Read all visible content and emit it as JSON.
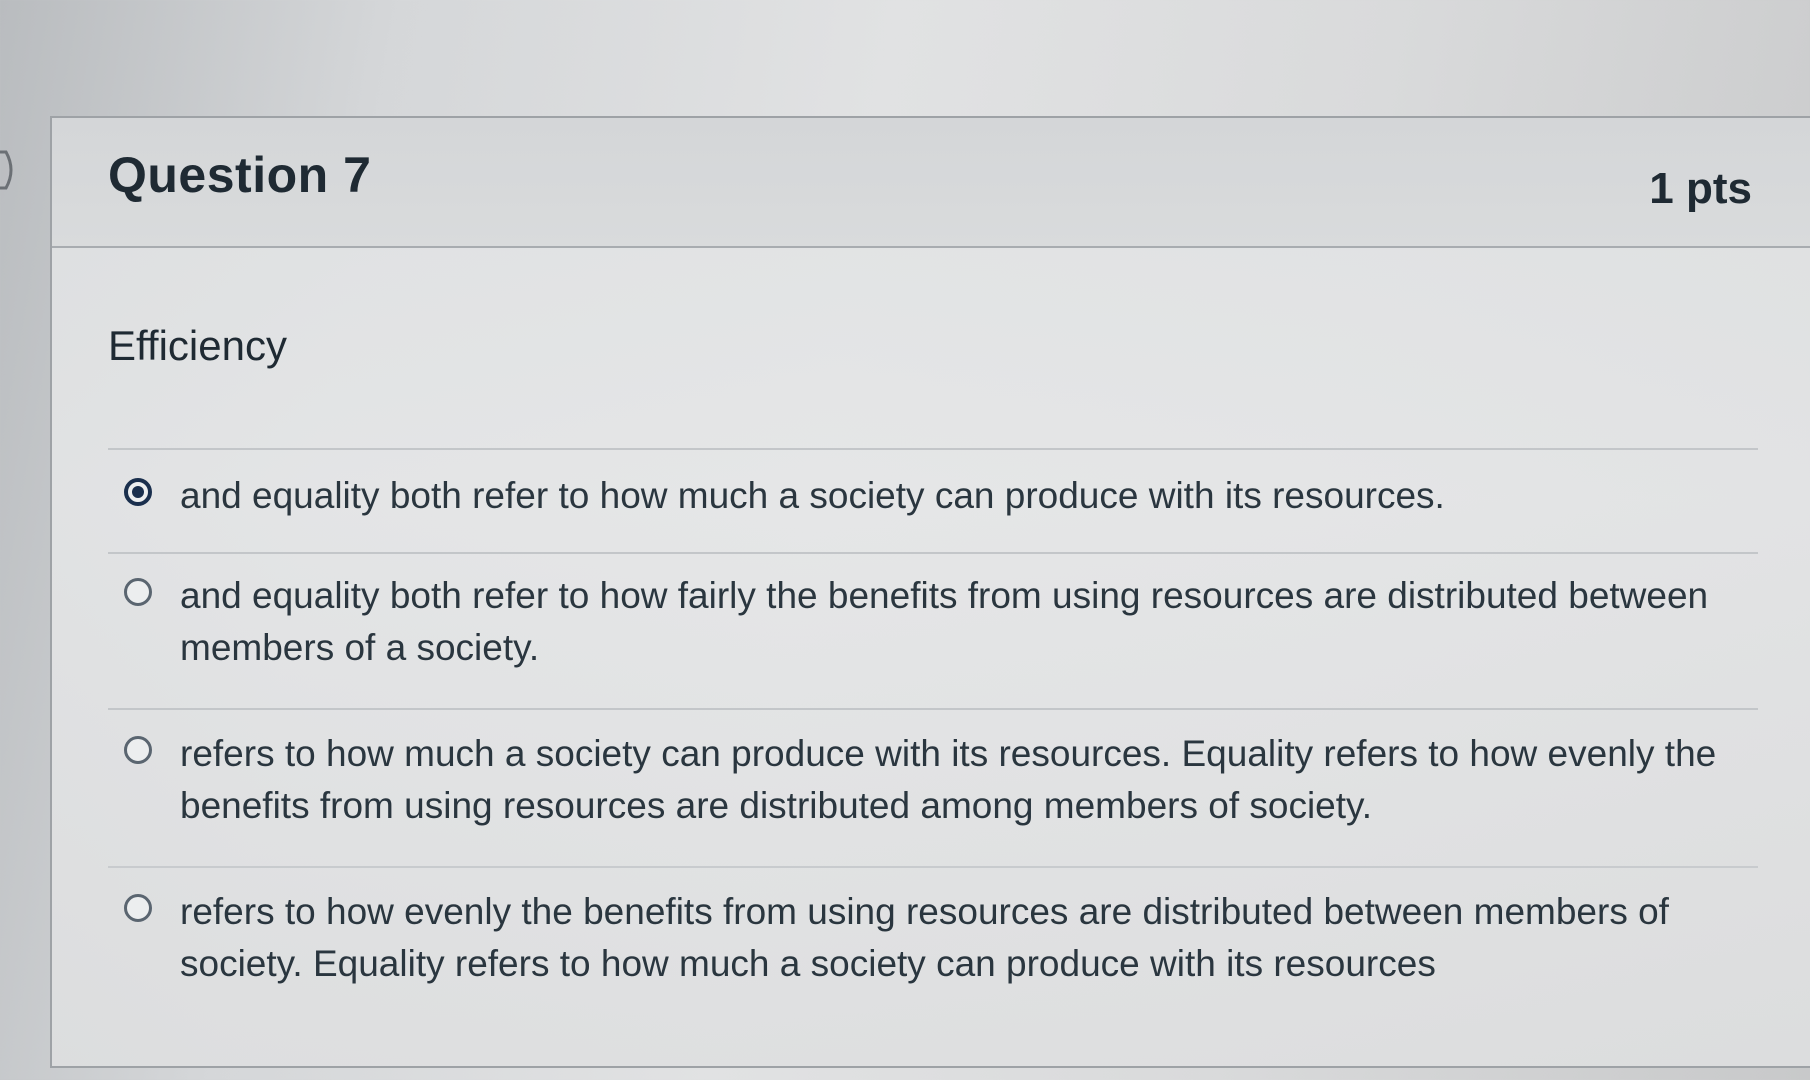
{
  "question": {
    "title": "Question 7",
    "points": "1 pts",
    "prompt": "Efficiency"
  },
  "answers": [
    {
      "text": "and equality both refer to how much a society can produce with its resources.",
      "selected": true
    },
    {
      "text": "and equality both refer to how fairly the benefits from using resources are distributed between members of a society.",
      "selected": false
    },
    {
      "text": "refers to how much a society can produce with its resources.  Equality refers to how evenly the benefits from using resources are distributed among members of society.",
      "selected": false
    },
    {
      "text": "refers to how evenly the benefits from using resources are distributed between members of society.  Equality refers to how much a society can produce with its resources",
      "selected": false
    }
  ],
  "colors": {
    "selected_radio": "#1a2f4d",
    "text": "#2d3b45",
    "border": "#9ea2a6"
  },
  "icons": {
    "nav": "chevron-right-icon"
  }
}
